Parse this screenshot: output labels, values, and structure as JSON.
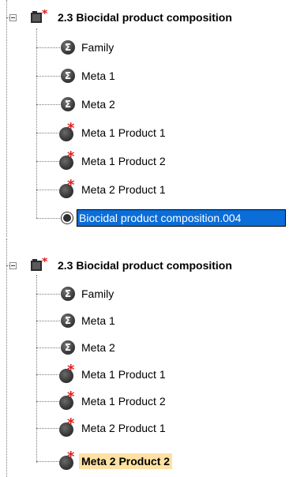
{
  "panels": [
    {
      "root_label": "2.3 Biocidal product composition",
      "items": [
        {
          "label": "Family",
          "icon": "sigma"
        },
        {
          "label": "Meta 1",
          "icon": "sigma"
        },
        {
          "label": "Meta 2",
          "icon": "sigma"
        },
        {
          "label": "Meta 1 Product 1",
          "icon": "bomb"
        },
        {
          "label": "Meta 1 Product 2",
          "icon": "bomb"
        },
        {
          "label": "Meta 2 Product 1",
          "icon": "bomb"
        }
      ],
      "editing_value": "Biocidal product composition.004"
    },
    {
      "root_label": "2.3 Biocidal product composition",
      "items": [
        {
          "label": "Family",
          "icon": "sigma"
        },
        {
          "label": "Meta 1",
          "icon": "sigma"
        },
        {
          "label": "Meta 2",
          "icon": "sigma"
        },
        {
          "label": "Meta 1 Product 1",
          "icon": "bomb"
        },
        {
          "label": "Meta 1 Product 2",
          "icon": "bomb"
        },
        {
          "label": "Meta 2 Product 1",
          "icon": "bomb"
        },
        {
          "label": "Meta 2 Product 2",
          "icon": "bomb",
          "selected": true
        }
      ]
    }
  ],
  "colors": {
    "selection_bg": "#ffe1a3",
    "edit_bg": "#0a6dd8",
    "asterisk": "#e11f1f"
  }
}
